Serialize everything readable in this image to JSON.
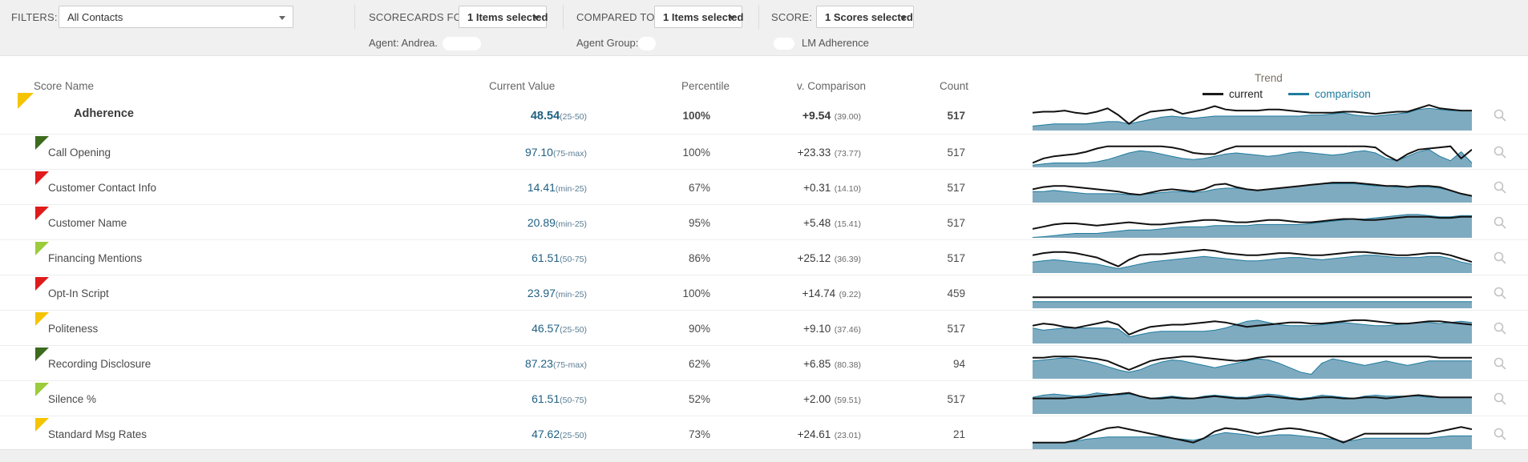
{
  "filters": {
    "filters_label": "FILTERS:",
    "filters_value": "All Contacts",
    "scorecards_label": "SCORECARDS FOR:",
    "scorecards_value": "1 Items selected",
    "compared_label": "COMPARED TO:",
    "compared_value": "1 Items selected",
    "score_label": "SCORE:",
    "score_value": "1 Scores selected",
    "agent_label": "Agent: Andrea.",
    "agent_group_label": "Agent Group:",
    "lm_adherence_label": "LM Adherence"
  },
  "table": {
    "headers": {
      "score_name": "Score Name",
      "current_value": "Current Value",
      "percentile": "Percentile",
      "comparison": "v. Comparison",
      "count": "Count",
      "trend": "Trend"
    },
    "legend": {
      "current": "current",
      "comparison": "comparison",
      "current_color": "#1a1a1a",
      "comparison_color": "#1f7b9e"
    },
    "colors": {
      "flag_red": "#e01b1b",
      "flag_yellow": "#f5c400",
      "flag_lightgreen": "#9ccb3b",
      "flag_darkgreen": "#3d6b1e",
      "value_blue": "#1f5f82",
      "area_fill": "#7fabc0"
    },
    "rows": [
      {
        "name": "Adherence",
        "flag": "#f5c400",
        "value": "48.54",
        "band": "(25-50)",
        "percentile": "100%",
        "comparison": "+9.54",
        "baseline": "(39.00)",
        "count": "517",
        "zoom_icon": "search-icon",
        "trend": {
          "current": [
            30,
            31,
            31,
            32,
            30,
            29,
            31,
            34,
            28,
            20,
            27,
            31,
            32,
            33,
            29,
            31,
            33,
            36,
            33,
            32,
            32,
            32,
            33,
            33,
            32,
            31,
            30,
            30,
            30,
            31,
            31,
            30,
            29,
            30,
            31,
            31,
            34,
            37,
            34,
            33,
            32,
            32
          ],
          "comparison": [
            18,
            19,
            20,
            20,
            20,
            20,
            21,
            22,
            22,
            20,
            22,
            24,
            26,
            27,
            26,
            25,
            26,
            27,
            27,
            27,
            27,
            27,
            27,
            27,
            27,
            27,
            28,
            28,
            29,
            30,
            28,
            27,
            27,
            28,
            29,
            30,
            33,
            34,
            33,
            32,
            32,
            32
          ]
        }
      },
      {
        "name": "Call Opening",
        "flag": "#3d6b1e",
        "value": "97.10",
        "band": "(75-max)",
        "percentile": "100%",
        "comparison": "+23.33",
        "baseline": "(73.77)",
        "count": "517",
        "zoom_icon": "search-icon",
        "trend": {
          "current": [
            18,
            22,
            24,
            25,
            26,
            28,
            31,
            33,
            33,
            33,
            33,
            33,
            33,
            32,
            30,
            27,
            26,
            26,
            30,
            33,
            33,
            33,
            33,
            33,
            33,
            33,
            33,
            33,
            33,
            33,
            33,
            33,
            32,
            25,
            20,
            26,
            30,
            31,
            32,
            33,
            22,
            30
          ],
          "comparison": [
            16,
            17,
            18,
            18,
            18,
            18,
            19,
            21,
            24,
            27,
            29,
            28,
            26,
            24,
            22,
            21,
            22,
            24,
            26,
            27,
            26,
            25,
            24,
            25,
            27,
            28,
            27,
            26,
            25,
            26,
            28,
            29,
            27,
            22,
            20,
            24,
            28,
            30,
            24,
            20,
            28,
            18
          ]
        }
      },
      {
        "name": "Customer Contact Info",
        "flag": "#e01b1b",
        "value": "14.41",
        "band": "(min-25)",
        "percentile": "67%",
        "comparison": "+0.31",
        "baseline": "(14.10)",
        "count": "517",
        "zoom_icon": "search-icon",
        "trend": {
          "current": [
            26,
            28,
            29,
            29,
            28,
            27,
            26,
            25,
            24,
            22,
            21,
            23,
            25,
            26,
            25,
            24,
            26,
            30,
            31,
            28,
            26,
            25,
            26,
            27,
            28,
            29,
            30,
            31,
            32,
            32,
            32,
            31,
            30,
            29,
            29,
            28,
            29,
            29,
            28,
            25,
            22,
            20
          ],
          "comparison": [
            24,
            24,
            25,
            24,
            23,
            22,
            22,
            22,
            22,
            21,
            21,
            22,
            23,
            24,
            24,
            23,
            24,
            26,
            27,
            27,
            26,
            25,
            26,
            27,
            28,
            29,
            30,
            31,
            31,
            31,
            31,
            30,
            29,
            29,
            28,
            28,
            28,
            28,
            27,
            25,
            22,
            20
          ]
        }
      },
      {
        "name": "Customer Name",
        "flag": "#e01b1b",
        "value": "20.89",
        "band": "(min-25)",
        "percentile": "95%",
        "comparison": "+5.48",
        "baseline": "(15.41)",
        "count": "517",
        "zoom_icon": "search-icon",
        "trend": {
          "current": [
            22,
            24,
            26,
            27,
            27,
            26,
            25,
            26,
            27,
            28,
            27,
            26,
            26,
            27,
            28,
            29,
            30,
            30,
            29,
            28,
            28,
            29,
            30,
            30,
            29,
            28,
            28,
            29,
            30,
            31,
            31,
            30,
            30,
            31,
            32,
            33,
            33,
            33,
            32,
            32,
            33,
            33
          ],
          "comparison": [
            14,
            15,
            16,
            17,
            18,
            18,
            18,
            19,
            20,
            21,
            21,
            21,
            22,
            23,
            24,
            24,
            24,
            25,
            25,
            25,
            25,
            26,
            26,
            26,
            26,
            26,
            27,
            28,
            29,
            30,
            31,
            31,
            32,
            33,
            34,
            35,
            35,
            34,
            33,
            33,
            34,
            34
          ]
        }
      },
      {
        "name": "Financing Mentions",
        "flag": "#9ccb3b",
        "value": "61.51",
        "band": "(50-75)",
        "percentile": "86%",
        "comparison": "+25.12",
        "baseline": "(36.39)",
        "count": "517",
        "zoom_icon": "search-icon",
        "trend": {
          "current": [
            30,
            32,
            33,
            33,
            32,
            30,
            28,
            24,
            20,
            26,
            30,
            31,
            31,
            32,
            33,
            34,
            35,
            34,
            32,
            31,
            30,
            30,
            31,
            32,
            32,
            31,
            30,
            30,
            31,
            32,
            33,
            33,
            32,
            31,
            30,
            30,
            31,
            32,
            32,
            30,
            27,
            24
          ],
          "comparison": [
            24,
            25,
            26,
            25,
            24,
            23,
            22,
            20,
            18,
            20,
            22,
            24,
            25,
            26,
            27,
            28,
            29,
            28,
            27,
            26,
            25,
            25,
            26,
            27,
            28,
            28,
            27,
            26,
            27,
            28,
            29,
            30,
            30,
            29,
            28,
            28,
            28,
            29,
            29,
            27,
            24,
            22
          ]
        }
      },
      {
        "name": "Opt-In Script",
        "flag": "#e01b1b",
        "value": "23.97",
        "band": "(min-25)",
        "percentile": "100%",
        "comparison": "+14.74",
        "baseline": "(9.22)",
        "count": "459",
        "zoom_icon": "search-icon",
        "trend": {
          "current": [
            24,
            24,
            24,
            24,
            24,
            24,
            24,
            24,
            24,
            24,
            24,
            24,
            24,
            24,
            24,
            24,
            24,
            24,
            24,
            24,
            24,
            24,
            24,
            24,
            24,
            24,
            24,
            24,
            24,
            24,
            24,
            24,
            24,
            24,
            24,
            24,
            24,
            24,
            24,
            24,
            24,
            24
          ],
          "comparison": [
            20,
            20,
            20,
            20,
            20,
            20,
            20,
            20,
            20,
            20,
            20,
            20,
            20,
            20,
            20,
            20,
            20,
            20,
            20,
            20,
            20,
            20,
            20,
            20,
            20,
            20,
            20,
            20,
            20,
            20,
            20,
            20,
            20,
            20,
            20,
            20,
            20,
            20,
            20,
            20,
            20,
            20
          ]
        }
      },
      {
        "name": "Politeness",
        "flag": "#f5c400",
        "value": "46.57",
        "band": "(25-50)",
        "percentile": "90%",
        "comparison": "+9.10",
        "baseline": "(37.46)",
        "count": "517",
        "zoom_icon": "search-icon",
        "trend": {
          "current": [
            30,
            32,
            31,
            29,
            28,
            30,
            32,
            34,
            31,
            22,
            26,
            29,
            30,
            31,
            31,
            32,
            33,
            34,
            33,
            31,
            29,
            30,
            31,
            32,
            33,
            33,
            32,
            32,
            33,
            34,
            35,
            35,
            34,
            33,
            32,
            32,
            33,
            34,
            34,
            33,
            32,
            31
          ],
          "comparison": [
            28,
            26,
            27,
            28,
            28,
            28,
            28,
            28,
            27,
            20,
            22,
            24,
            25,
            25,
            25,
            25,
            25,
            26,
            28,
            31,
            34,
            35,
            33,
            31,
            30,
            30,
            30,
            31,
            32,
            33,
            32,
            31,
            30,
            30,
            31,
            32,
            33,
            33,
            32,
            33,
            34,
            33
          ]
        }
      },
      {
        "name": "Recording Disclosure",
        "flag": "#3d6b1e",
        "value": "87.23",
        "band": "(75-max)",
        "percentile": "62%",
        "comparison": "+6.85",
        "baseline": "(80.38)",
        "count": "94",
        "zoom_icon": "search-icon",
        "trend": {
          "current": [
            33,
            33,
            34,
            34,
            34,
            33,
            32,
            30,
            26,
            22,
            26,
            30,
            32,
            33,
            34,
            34,
            33,
            32,
            31,
            30,
            31,
            33,
            34,
            34,
            34,
            34,
            34,
            34,
            34,
            34,
            34,
            34,
            34,
            34,
            34,
            34,
            34,
            34,
            33,
            33,
            33,
            33
          ],
          "comparison": [
            30,
            31,
            32,
            33,
            32,
            30,
            28,
            25,
            22,
            20,
            22,
            26,
            29,
            31,
            30,
            28,
            26,
            24,
            26,
            28,
            30,
            32,
            31,
            28,
            24,
            20,
            18,
            28,
            32,
            30,
            28,
            26,
            28,
            30,
            28,
            26,
            28,
            30,
            30,
            30,
            30,
            30
          ]
        }
      },
      {
        "name": "Silence %",
        "flag": "#9ccb3b",
        "value": "61.51",
        "band": "(50-75)",
        "percentile": "52%",
        "comparison": "+2.00",
        "baseline": "(59.51)",
        "count": "517",
        "zoom_icon": "search-icon",
        "trend": {
          "current": [
            28,
            28,
            28,
            28,
            29,
            29,
            30,
            31,
            32,
            33,
            30,
            28,
            28,
            29,
            28,
            28,
            29,
            30,
            29,
            28,
            28,
            29,
            30,
            29,
            28,
            27,
            28,
            29,
            29,
            28,
            28,
            29,
            29,
            28,
            29,
            30,
            31,
            30,
            29,
            29,
            29,
            29
          ],
          "comparison": [
            29,
            31,
            32,
            31,
            30,
            31,
            33,
            32,
            31,
            32,
            30,
            28,
            29,
            30,
            29,
            28,
            30,
            31,
            30,
            29,
            29,
            31,
            32,
            31,
            29,
            28,
            29,
            31,
            30,
            29,
            28,
            30,
            31,
            30,
            30,
            30,
            30,
            29,
            29,
            29,
            29,
            29
          ]
        }
      },
      {
        "name": "Standard Msg Rates",
        "flag": "#f5c400",
        "value": "47.62",
        "band": "(25-50)",
        "percentile": "73%",
        "comparison": "+24.61",
        "baseline": "(23.01)",
        "count": "21",
        "zoom_icon": "search-icon",
        "trend": {
          "current": [
            20,
            20,
            20,
            20,
            22,
            26,
            30,
            33,
            34,
            32,
            30,
            28,
            26,
            24,
            22,
            20,
            24,
            30,
            33,
            32,
            30,
            28,
            30,
            32,
            33,
            32,
            30,
            28,
            24,
            20,
            24,
            28,
            28,
            28,
            28,
            28,
            28,
            28,
            30,
            32,
            34,
            32
          ],
          "comparison": [
            20,
            20,
            20,
            20,
            21,
            23,
            24,
            25,
            25,
            25,
            25,
            25,
            25,
            24,
            23,
            22,
            24,
            27,
            29,
            28,
            27,
            25,
            26,
            27,
            27,
            26,
            25,
            24,
            23,
            21,
            22,
            24,
            24,
            24,
            24,
            24,
            24,
            24,
            25,
            26,
            26,
            26
          ]
        }
      }
    ]
  }
}
